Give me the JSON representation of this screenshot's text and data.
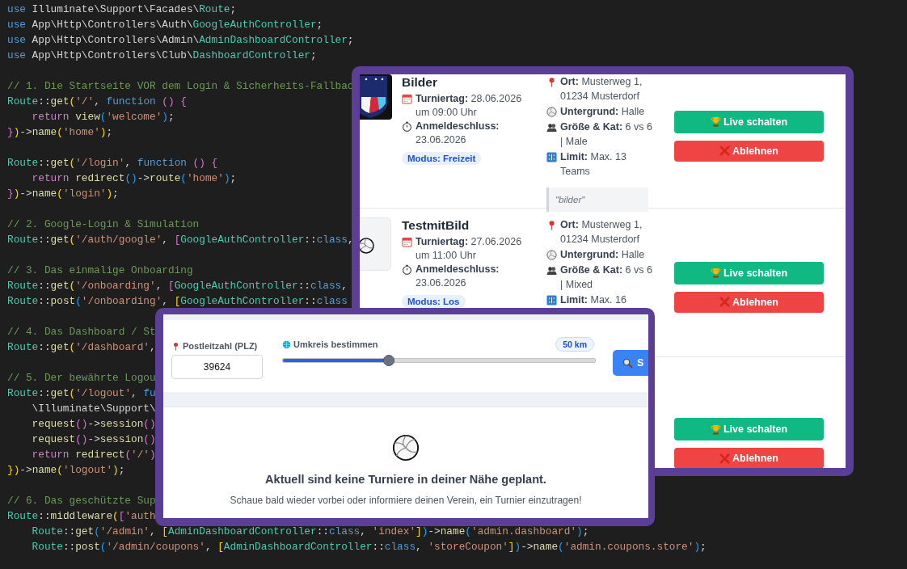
{
  "editor": {
    "blocks": [
      {
        "lines": [
          "use Illuminate\\Support\\Facades\\Route;",
          "use App\\Http\\Controllers\\Auth\\GoogleAuthController;",
          "use App\\Http\\Controllers\\Admin\\AdminDashboardController;",
          "use App\\Http\\Controllers\\Club\\DashboardController;"
        ]
      },
      {
        "lines": [
          "// 1. Die Startseite VOR dem Login & Sicherheits-Fallbac",
          "Route::get('/', function () {",
          "    return view('welcome');",
          "})->name('home');"
        ]
      },
      {
        "lines": [
          "Route::get('/login', function () {",
          "    return redirect()->route('home');",
          "})->name('login');"
        ]
      },
      {
        "lines": [
          "// 2. Google-Login & Simulation",
          "Route::get('/auth/google', [GoogleAuthController::class,"
        ]
      },
      {
        "lines": [
          "// 3. Das einmalige Onboarding",
          "Route::get('/onboarding', [GoogleAuthController::class,",
          "Route::post('/onboarding', [GoogleAuthController::class"
        ]
      },
      {
        "lines": [
          "// 4. Das Dashboard / St",
          "Route::get('/dashboard',"
        ]
      },
      {
        "lines": [
          "// 5. Der bewährte Logou",
          "Route::get('/logout', fu",
          "    \\Illuminate\\Support\\",
          "    request()->session()",
          "    request()->session()",
          "    return redirect('/')",
          "})->name('logout');"
        ]
      },
      {
        "lines": [
          "// 6. Das geschützte Sup",
          "Route::middleware(['auth",
          "    Route::get('/admin', [AdminDashboardController::class, 'index'])->name('admin.dashboard');",
          "    Route::post('/admin/coupons', [AdminDashboardController::class, 'storeCoupon'])->name('admin.coupons.store');"
        ]
      }
    ]
  },
  "admin_window": {
    "cards": [
      {
        "image": {
          "kind": "logo"
        },
        "title": "Bilder",
        "details": [
          {
            "kind": "date",
            "text": "**Turniertag:** 28.06.2026 um 09:00 Uhr"
          },
          {
            "kind": "deadline",
            "text": "**Anmeldeschluss:** 23.06.2026"
          }
        ],
        "mode": "Modus: Freizeit",
        "facts": [
          {
            "kind": "location",
            "text": "**Ort:** Musterweg 1, 01234 Musterdorf"
          },
          {
            "kind": "surface",
            "text": "**Untergrund:** Halle"
          },
          {
            "kind": "size",
            "text": "**Größe & Kat:** 6 vs 6 | Male"
          },
          {
            "kind": "limit",
            "text": "**Limit:** Max. 13 Teams"
          }
        ],
        "note": "\"bilder\"",
        "buttons": [
          {
            "kind": "approve",
            "label": "Live schalten"
          },
          {
            "kind": "reject",
            "label": "Ablehnen"
          }
        ]
      },
      {
        "image": {
          "kind": "placeholder"
        },
        "title": "TestmitBild",
        "details": [
          {
            "kind": "date",
            "text": "**Turniertag:** 27.06.2026 um 11:00 Uhr"
          },
          {
            "kind": "deadline",
            "text": "**Anmeldeschluss:** 23.06.2026"
          }
        ],
        "mode": "Modus: Los",
        "facts": [
          {
            "kind": "location",
            "text": "**Ort:** Musterweg 1, 01234 Musterdorf"
          },
          {
            "kind": "surface",
            "text": "**Untergrund:** Halle"
          },
          {
            "kind": "size",
            "text": "**Größe & Kat:** 6 vs 6 | Mixed"
          },
          {
            "kind": "limit",
            "text": "**Limit:** Max. 16"
          }
        ],
        "buttons": [
          {
            "kind": "approve",
            "label": "Live schalten"
          },
          {
            "kind": "reject",
            "label": "Ablehnen"
          }
        ]
      },
      {
        "buttons": [
          {
            "kind": "approve",
            "label": "Live schalten"
          },
          {
            "kind": "reject",
            "label": "Ablehnen"
          }
        ]
      }
    ]
  },
  "search_window": {
    "zip": {
      "label": "Postleitzahl (PLZ)",
      "value": "39624"
    },
    "radius": {
      "label": "Umkreis bestimmen",
      "reading": "50 km",
      "level": 0.34
    },
    "search_button": {
      "label": "S"
    },
    "empty_state": {
      "title": "Aktuell sind keine Turniere in deiner Nähe geplant.",
      "text": "Schaue bald wieder vorbei oder informiere deinen Verein, ein Turnier einzutragen!"
    }
  }
}
